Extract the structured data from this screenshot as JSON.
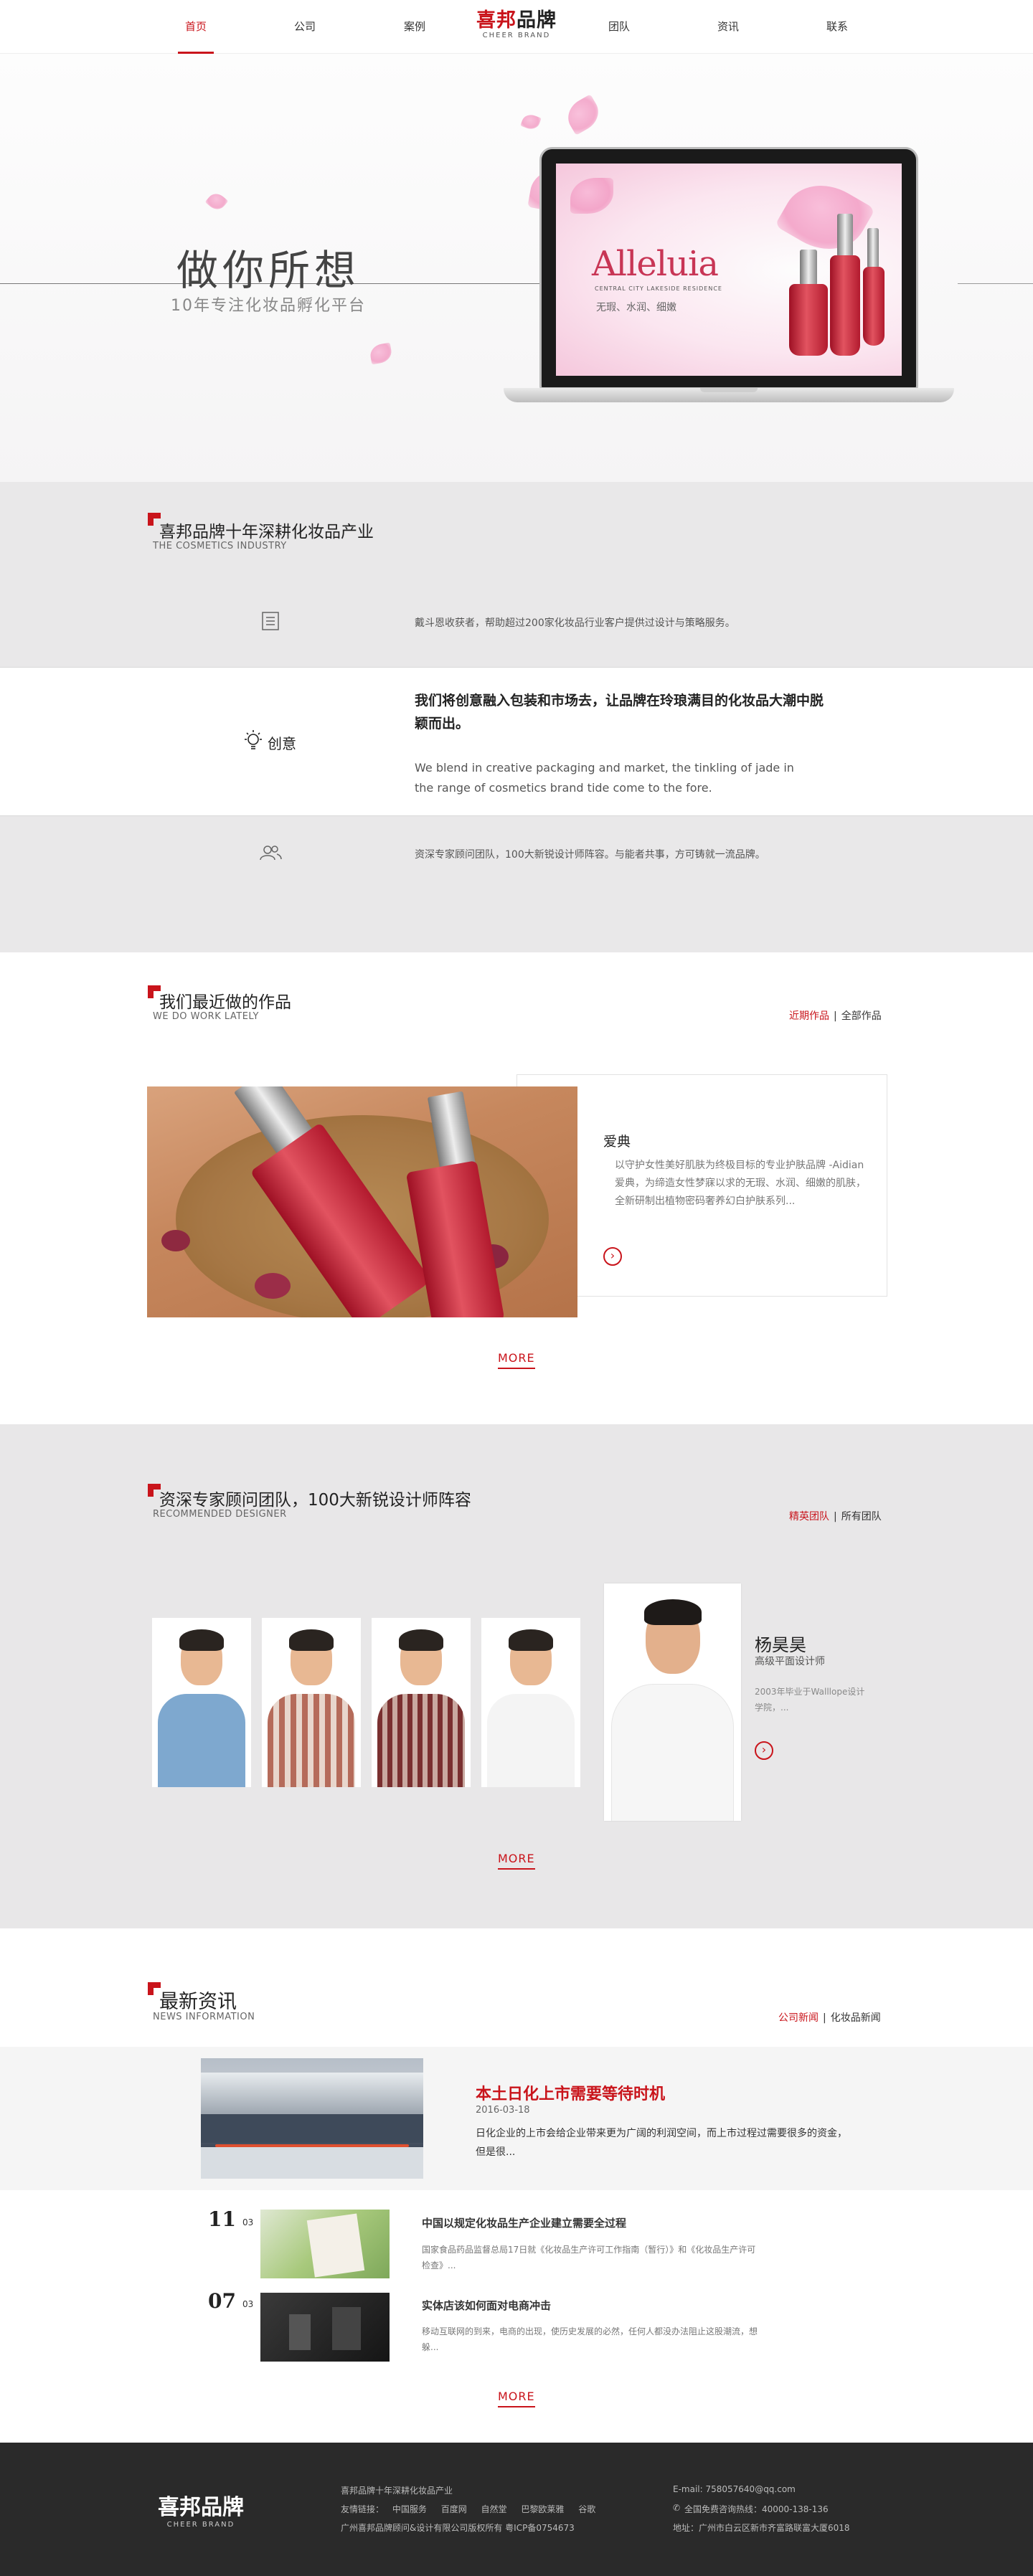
{
  "nav": {
    "left_items": [
      "首页",
      "公司",
      "案例"
    ],
    "right_items": [
      "团队",
      "资讯",
      "联系"
    ],
    "logo_cn_red": "喜邦",
    "logo_cn_black": "品牌",
    "logo_en": "CHEER BRAND",
    "accent": "#c9141b"
  },
  "hero": {
    "title": "做你所想",
    "subtitle": "10年专注化妆品孵化平台",
    "screen_brand": "Alleluia",
    "screen_brand_sub": "CENTRAL CITY LAKESIDE RESIDENCE",
    "screen_tagline": "无瑕、水润、细嫩"
  },
  "industry": {
    "title": "喜邦品牌十年深耕化妆品产业",
    "subtitle": "THE COSMETICS INDUSTRY",
    "row1_text": "戴斗恩收获者，帮助超过200家化妆品行业客户提供过设计与策略服务。",
    "row2_label": "创意",
    "row2_big": "我们将创意融入包装和市场去，让品牌在玲琅满目的化妆品大潮中脱颖而出。",
    "row2_en": "We blend in creative packaging and market, the tinkling of jade in the range of cosmetics brand tide come to the fore.",
    "row3_text": "资深专家顾问团队，100大新锐设计师阵容。与能者共事，方可铸就一流品牌。"
  },
  "works": {
    "title": "我们最近做的作品",
    "subtitle": "WE DO WORK LATELY",
    "tab_active": "近期作品",
    "tab_other": "全部作品",
    "tab_sep": "|",
    "item_name": "爱典",
    "item_desc": "以守护女性美好肌肤为终极目标的专业护肤品牌 -Aidian爱典，为缔造女性梦寐以求的无瑕、水润、细嫩的肌肤，全新研制出植物密码奢养幻白护肤系列...",
    "more": "MORE"
  },
  "team": {
    "title": "资深专家顾问团队，100大新锐设计师阵容",
    "subtitle": "RECOMMENDED DESIGNER",
    "tab_active": "精英团队",
    "tab_other": "所有团队",
    "tab_sep": "|",
    "featured_name": "杨昊昊",
    "featured_role": "高级平面设计师",
    "featured_desc": "2003年毕业于Walllope设计学院，...",
    "more": "MORE"
  },
  "news": {
    "title": "最新资讯",
    "subtitle": "NEWS INFORMATION",
    "tab_active": "公司新闻",
    "tab_other": "化妆品新闻",
    "tab_sep": "|",
    "featured": {
      "title": "本土日化上市需要等待时机",
      "date": "2016-03-18",
      "desc": "日化企业的上市会给企业带来更为广阔的利润空间，而上市过程过需要很多的资金，但是很..."
    },
    "items": [
      {
        "day": "11",
        "month": "03",
        "title": "中国以规定化妆品生产企业建立需要全过程",
        "desc": "国家食品药品监督总局17日就《化妆品生产许可工作指南（暂行）》和《化妆品生产许可检查》..."
      },
      {
        "day": "07",
        "month": "03",
        "title": "实体店该如何面对电商冲击",
        "desc": "移动互联网的到来，电商的出现，使历史发展的必然，任何人都没办法阻止这股潮流，想躲..."
      }
    ],
    "more": "MORE"
  },
  "footer": {
    "logo_cn": "喜邦品牌",
    "logo_en": "CHEER BRAND",
    "slogan": "喜邦品牌十年深耕化妆品产业",
    "links_label": "友情链接：",
    "links": [
      "中国服务",
      "百度网",
      "自然堂",
      "巴黎欧莱雅",
      "谷歌"
    ],
    "copyright": "广州喜邦品牌顾问&设计有限公司版权所有   粤ICP备0754673",
    "email": "E-mail: 758057640@qq.com",
    "hotline": "全国免费咨询热线：40000-138-136",
    "address": "地址：广州市白云区新市齐富路联富大厦6018"
  }
}
